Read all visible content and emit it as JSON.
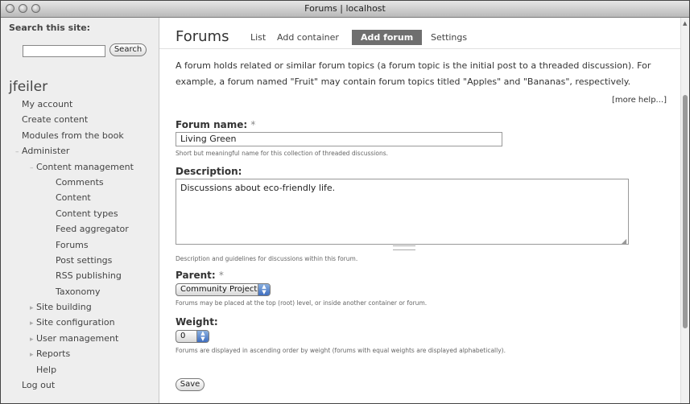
{
  "window": {
    "title": "Forums | localhost"
  },
  "sidebar": {
    "search_label": "Search this site:",
    "search_value": "",
    "search_button": "Search",
    "username": "jfeiler",
    "items": [
      {
        "label": "My account"
      },
      {
        "label": "Create content"
      },
      {
        "label": "Modules from the book"
      },
      {
        "label": "Administer"
      },
      {
        "label": "Content management"
      },
      {
        "label": "Comments"
      },
      {
        "label": "Content"
      },
      {
        "label": "Content types"
      },
      {
        "label": "Feed aggregator"
      },
      {
        "label": "Forums"
      },
      {
        "label": "Post settings"
      },
      {
        "label": "RSS publishing"
      },
      {
        "label": "Taxonomy"
      },
      {
        "label": "Site building"
      },
      {
        "label": "Site configuration"
      },
      {
        "label": "User management"
      },
      {
        "label": "Reports"
      },
      {
        "label": "Help"
      },
      {
        "label": "Log out"
      }
    ]
  },
  "main": {
    "heading": "Forums",
    "tabs": [
      {
        "label": "List"
      },
      {
        "label": "Add container"
      },
      {
        "label": "Add forum"
      },
      {
        "label": "Settings"
      }
    ],
    "help_text": "A forum holds related or similar forum topics (a forum topic is the initial post to a threaded discussion). For example, a forum named \"Fruit\" may contain forum topics titled \"Apples\" and \"Bananas\", respectively.",
    "more_help": "[more help...]",
    "forum_name": {
      "label": "Forum name:",
      "required": "*",
      "value": "Living Green",
      "description": "Short but meaningful name for this collection of threaded discussions."
    },
    "description": {
      "label": "Description:",
      "value": "Discussions about eco-friendly life.",
      "description": "Description and guidelines for discussions within this forum."
    },
    "parent": {
      "label": "Parent:",
      "required": "*",
      "selected": "Community Projects",
      "description": "Forums may be placed at the top (root) level, or inside another container or forum."
    },
    "weight": {
      "label": "Weight:",
      "selected": "0",
      "description": "Forums are displayed in ascending order by weight (forums with equal weights are displayed alphabetically)."
    },
    "save_button": "Save"
  }
}
